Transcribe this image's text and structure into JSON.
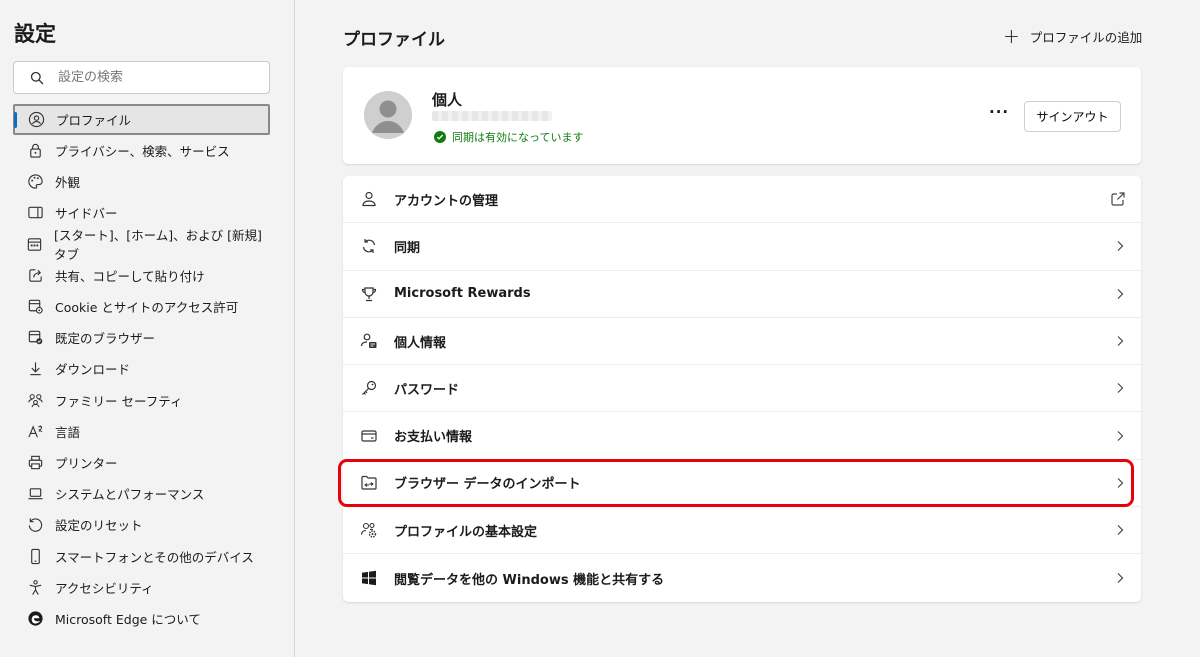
{
  "sidebar": {
    "title": "設定",
    "search_placeholder": "設定の検索",
    "items": [
      {
        "label": "プロファイル",
        "icon": "profile-icon"
      },
      {
        "label": "プライバシー、検索、サービス",
        "icon": "lock-icon"
      },
      {
        "label": "外観",
        "icon": "palette-icon"
      },
      {
        "label": "サイドバー",
        "icon": "sidebar-icon"
      },
      {
        "label": "[スタート]、[ホーム]、および [新規] タブ",
        "icon": "home-tab-icon"
      },
      {
        "label": "共有、コピーして貼り付け",
        "icon": "share-icon"
      },
      {
        "label": "Cookie とサイトのアクセス許可",
        "icon": "cookie-icon"
      },
      {
        "label": "既定のブラウザー",
        "icon": "default-browser-icon"
      },
      {
        "label": "ダウンロード",
        "icon": "download-icon"
      },
      {
        "label": "ファミリー セーフティ",
        "icon": "family-icon"
      },
      {
        "label": "言語",
        "icon": "language-icon"
      },
      {
        "label": "プリンター",
        "icon": "printer-icon"
      },
      {
        "label": "システムとパフォーマンス",
        "icon": "laptop-icon"
      },
      {
        "label": "設定のリセット",
        "icon": "reset-icon"
      },
      {
        "label": "スマートフォンとその他のデバイス",
        "icon": "phone-icon"
      },
      {
        "label": "アクセシビリティ",
        "icon": "accessibility-icon"
      },
      {
        "label": "Microsoft Edge について",
        "icon": "edge-logo-icon"
      }
    ]
  },
  "main": {
    "title": "プロファイル",
    "add_profile_label": "プロファイルの追加",
    "profile": {
      "name": "個人",
      "sync_status": "同期は有効になっています",
      "more_label": "···",
      "signout_label": "サインアウト"
    },
    "rows": [
      {
        "label": "アカウントの管理",
        "icon": "person-outline-icon",
        "trail": "external-link-icon"
      },
      {
        "label": "同期",
        "icon": "sync-icon",
        "trail": "chevron-right-icon"
      },
      {
        "label": "Microsoft Rewards",
        "icon": "trophy-icon",
        "trail": "chevron-right-icon"
      },
      {
        "label": "個人情報",
        "icon": "personal-info-icon",
        "trail": "chevron-right-icon"
      },
      {
        "label": "パスワード",
        "icon": "key-icon",
        "trail": "chevron-right-icon"
      },
      {
        "label": "お支払い情報",
        "icon": "card-icon",
        "trail": "chevron-right-icon"
      },
      {
        "label": "ブラウザー データのインポート",
        "icon": "import-folder-icon",
        "trail": "chevron-right-icon"
      },
      {
        "label": "プロファイルの基本設定",
        "icon": "people-settings-icon",
        "trail": "chevron-right-icon"
      },
      {
        "label": "閲覧データを他の Windows 機能と共有する",
        "icon": "windows-logo-icon",
        "trail": "chevron-right-icon"
      }
    ]
  },
  "colors": {
    "accent": "#0f6cbd",
    "sync_green": "#107c10",
    "highlight_red": "#e8000b"
  }
}
